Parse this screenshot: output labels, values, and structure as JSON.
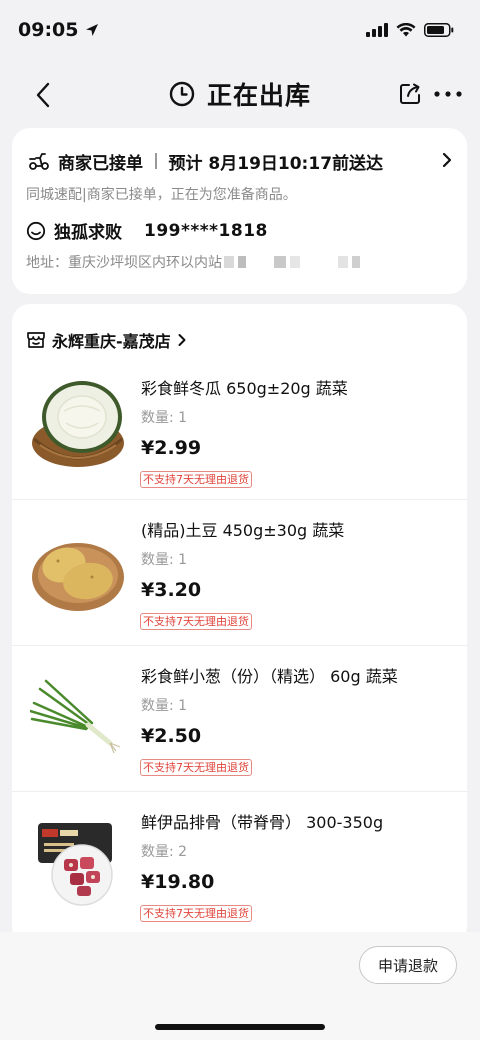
{
  "status_bar": {
    "time": "09:05"
  },
  "nav": {
    "title": "正在出库"
  },
  "delivery": {
    "status": "商家已接单",
    "eta": "预计 8月19日10:17前送达",
    "desc": "同城速配|商家已接单，正在为您准备商品。",
    "contact_name": "独孤求败",
    "contact_phone": "199****1818",
    "address_label": "地址：",
    "address": "重庆沙坪坝区内环以内站"
  },
  "store": {
    "name": "永辉重庆-嘉茂店"
  },
  "items": [
    {
      "name": "彩食鲜冬瓜 650g±20g 蔬菜",
      "qty": "数量: 1",
      "price": "¥2.99",
      "badge": "不支持7天无理由退货"
    },
    {
      "name": "(精品)土豆 450g±30g 蔬菜",
      "qty": "数量: 1",
      "price": "¥3.20",
      "badge": "不支持7天无理由退货"
    },
    {
      "name": "彩食鲜小葱（份）（精选） 60g 蔬菜",
      "qty": "数量: 1",
      "price": "¥2.50",
      "badge": "不支持7天无理由退货"
    },
    {
      "name": "鲜伊品排骨（带脊骨） 300-350g",
      "qty": "数量: 2",
      "price": "¥19.80",
      "badge": "不支持7天无理由退货"
    }
  ],
  "bottom": {
    "refund_label": "申请退款"
  },
  "colors": {
    "badge_red": "#e0443a",
    "background": "#f2f2f4"
  }
}
